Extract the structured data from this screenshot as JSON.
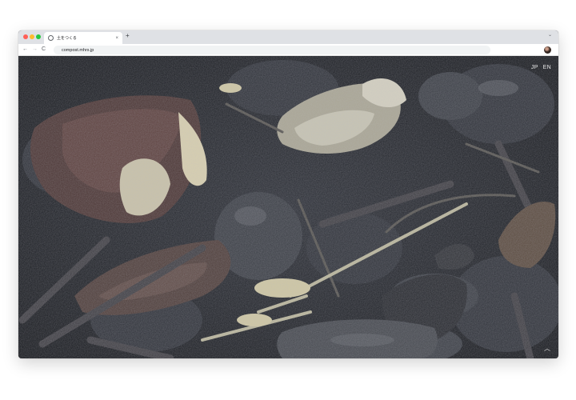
{
  "browser": {
    "tab": {
      "title": "土をつくる",
      "close": "×"
    },
    "new_tab": "+",
    "tab_menu": "⌄",
    "nav": {
      "back": "←",
      "forward": "→",
      "reload": "C"
    },
    "address": "compost.mhrs.jp"
  },
  "site": {
    "languages": [
      "JP",
      "EN"
    ],
    "scroll_top": "︿",
    "hero_image": "close-up photo of dark decomposing compost: leaves, shells, twigs"
  }
}
